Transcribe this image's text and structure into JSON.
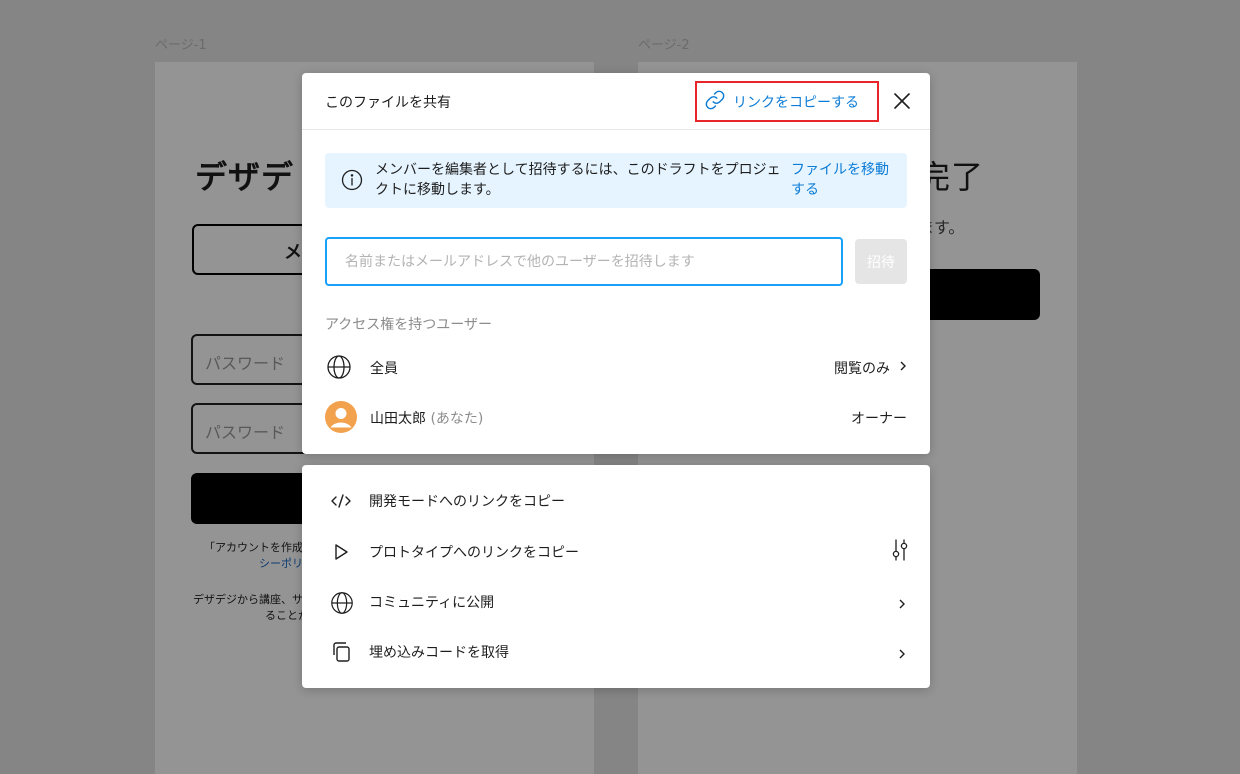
{
  "canvas": {
    "page1_label": "ページ-1",
    "page2_label": "ページ-2",
    "frame1": {
      "heading": "デザデ",
      "email_button": "メ",
      "password_placeholder_1": "パスワード",
      "password_placeholder_2": "パスワード",
      "terms_line1": "「アカウントを作成」",
      "terms_line2": "シーポリ",
      "footer_line1": "デザデジから講座、サ",
      "footer_line2": "ることか"
    },
    "frame2": {
      "heading": "完了",
      "subtext": "ます。"
    }
  },
  "share_dialog": {
    "title": "このファイルを共有",
    "copy_link_label": "リンクをコピーする",
    "info_message": "メンバーを編集者として招待するには、このドラフトをプロジェクトに移動します。",
    "info_link": "ファイルを移動する",
    "invite_placeholder": "名前またはメールアドレスで他のユーザーを招待します",
    "invite_button": "招待",
    "access_section_label": "アクセス権を持つユーザー",
    "access_rows": [
      {
        "name": "全員",
        "suffix": "",
        "permission": "閲覧のみ"
      },
      {
        "name": "山田太郎",
        "suffix": "(あなた)",
        "permission": "オーナー"
      }
    ]
  },
  "menu": {
    "items": [
      {
        "label": "開発モードへのリンクをコピー",
        "icon": "code-icon"
      },
      {
        "label": "プロトタイプへのリンクをコピー",
        "icon": "play-icon"
      },
      {
        "label": "コミュニティに公開",
        "icon": "globe-icon"
      },
      {
        "label": "埋め込みコードを取得",
        "icon": "embed-icon"
      }
    ]
  },
  "colors": {
    "accent_link": "#0d7cd6",
    "highlight_border": "#e8262a",
    "input_focus": "#18a0fb",
    "info_bg": "#e5f4ff",
    "avatar": "#f2a14d"
  }
}
